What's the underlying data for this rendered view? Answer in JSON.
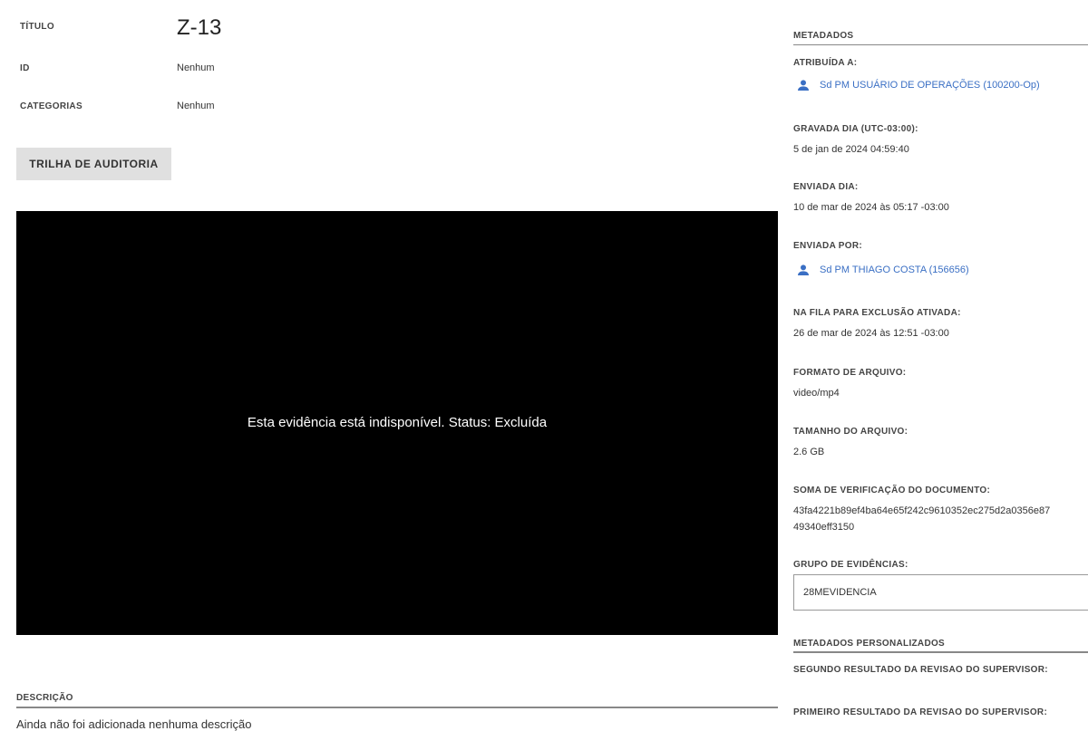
{
  "details": {
    "title_label": "TÍTULO",
    "title_value": "Z-13",
    "id_label": "ID",
    "id_value": "Nenhum",
    "categories_label": "CATEGORIAS",
    "categories_value": "Nenhum",
    "audit_button": "TRILHA DE AUDITORIA"
  },
  "player": {
    "message": "Esta evidência está indisponível. Status: Excluída"
  },
  "description": {
    "label": "DESCRIÇÃO",
    "text": "Ainda não foi adicionada nenhuma descrição"
  },
  "metadata": {
    "header": "METADADOS",
    "assigned_label": "ATRIBUÍDA A:",
    "assigned_value": "Sd PM USUÁRIO DE OPERAÇÕES (100200-Op)",
    "recorded_label": "GRAVADA DIA (UTC-03:00):",
    "recorded_value": "5 de jan de 2024 04:59:40",
    "sent_label": "ENVIADA DIA:",
    "sent_value": "10 de mar de 2024 às 05:17 -03:00",
    "sent_by_label": "ENVIADA POR:",
    "sent_by_value": "Sd PM THIAGO COSTA (156656)",
    "queued_label": "NA FILA PARA EXCLUSÃO ATIVADA:",
    "queued_value": "26 de mar de 2024 às 12:51 -03:00",
    "format_label": "FORMATO DE ARQUIVO:",
    "format_value": "video/mp4",
    "size_label": "TAMANHO DO ARQUIVO:",
    "size_value": "2.6 GB",
    "checksum_label": "SOMA DE VERIFICAÇÃO DO DOCUMENTO:",
    "checksum_line1": "43fa4221b89ef4ba64e65f242c9610352ec275d2a0356e87",
    "checksum_line2": "49340eff3150",
    "group_label": "GRUPO DE EVIDÊNCIAS:",
    "group_value": "28MEVIDENCIA",
    "custom_header": "METADADOS PERSONALIZADOS",
    "second_review_label": "SEGUNDO RESULTADO DA REVISAO DO SUPERVISOR:",
    "first_review_label": "PRIMEIRO RESULTADO DA REVISAO DO SUPERVISOR:"
  },
  "colors": {
    "link": "#3a6fc4",
    "player_bg": "#000000",
    "button_bg": "#e0e0e0"
  },
  "icons": {
    "user": "person-icon"
  }
}
